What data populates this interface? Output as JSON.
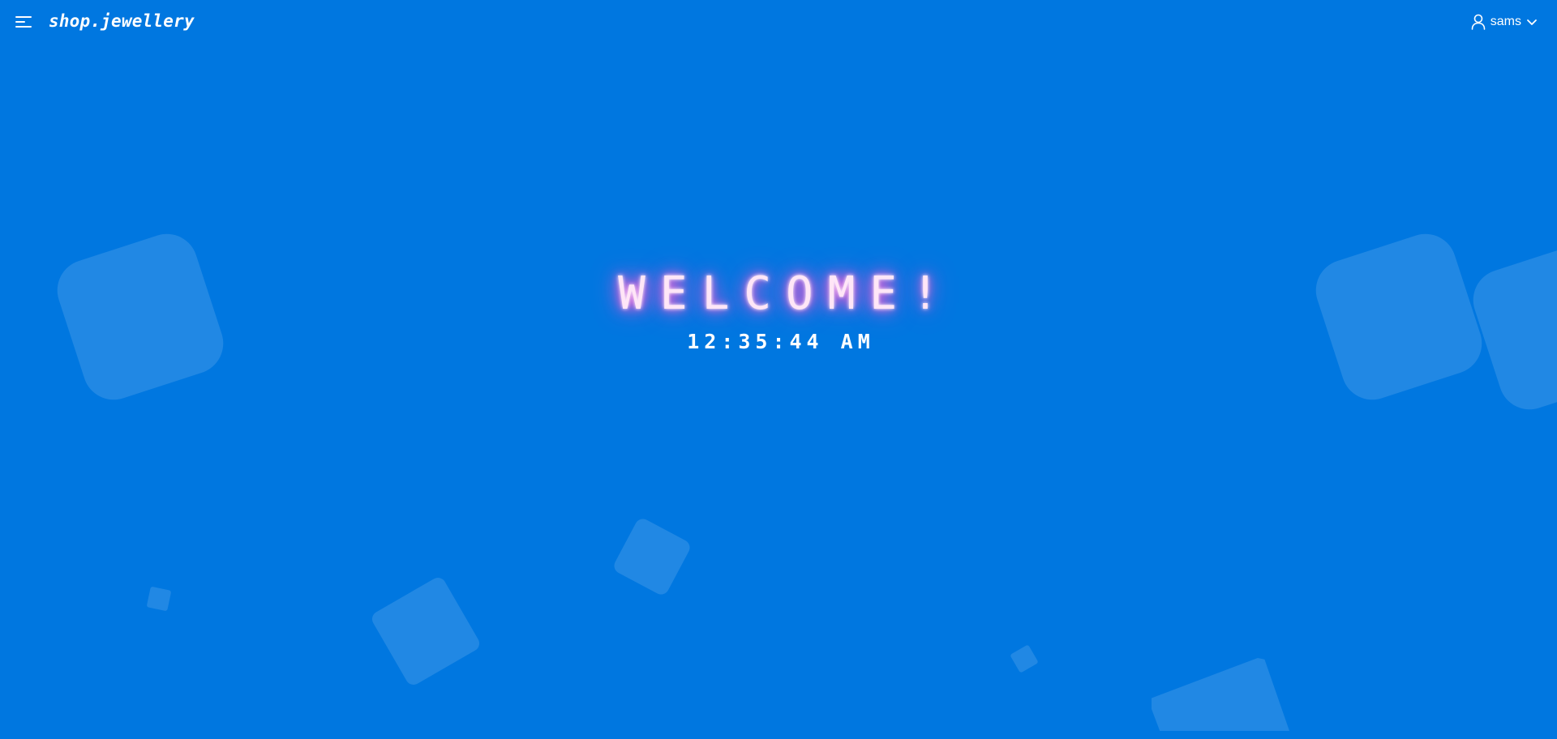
{
  "header": {
    "brand": "shop.jewellery",
    "menu_icon": "hamburger-icon",
    "user": {
      "name": "sams",
      "icon": "user-icon",
      "dropdown_icon": "chevron-down-icon"
    }
  },
  "hero": {
    "welcome": "WELCOME!",
    "clock": "12:35:44 AM"
  },
  "colors": {
    "background": "#0077e0",
    "text": "#ffffff",
    "welcome_glow": "#ff4fd8"
  }
}
